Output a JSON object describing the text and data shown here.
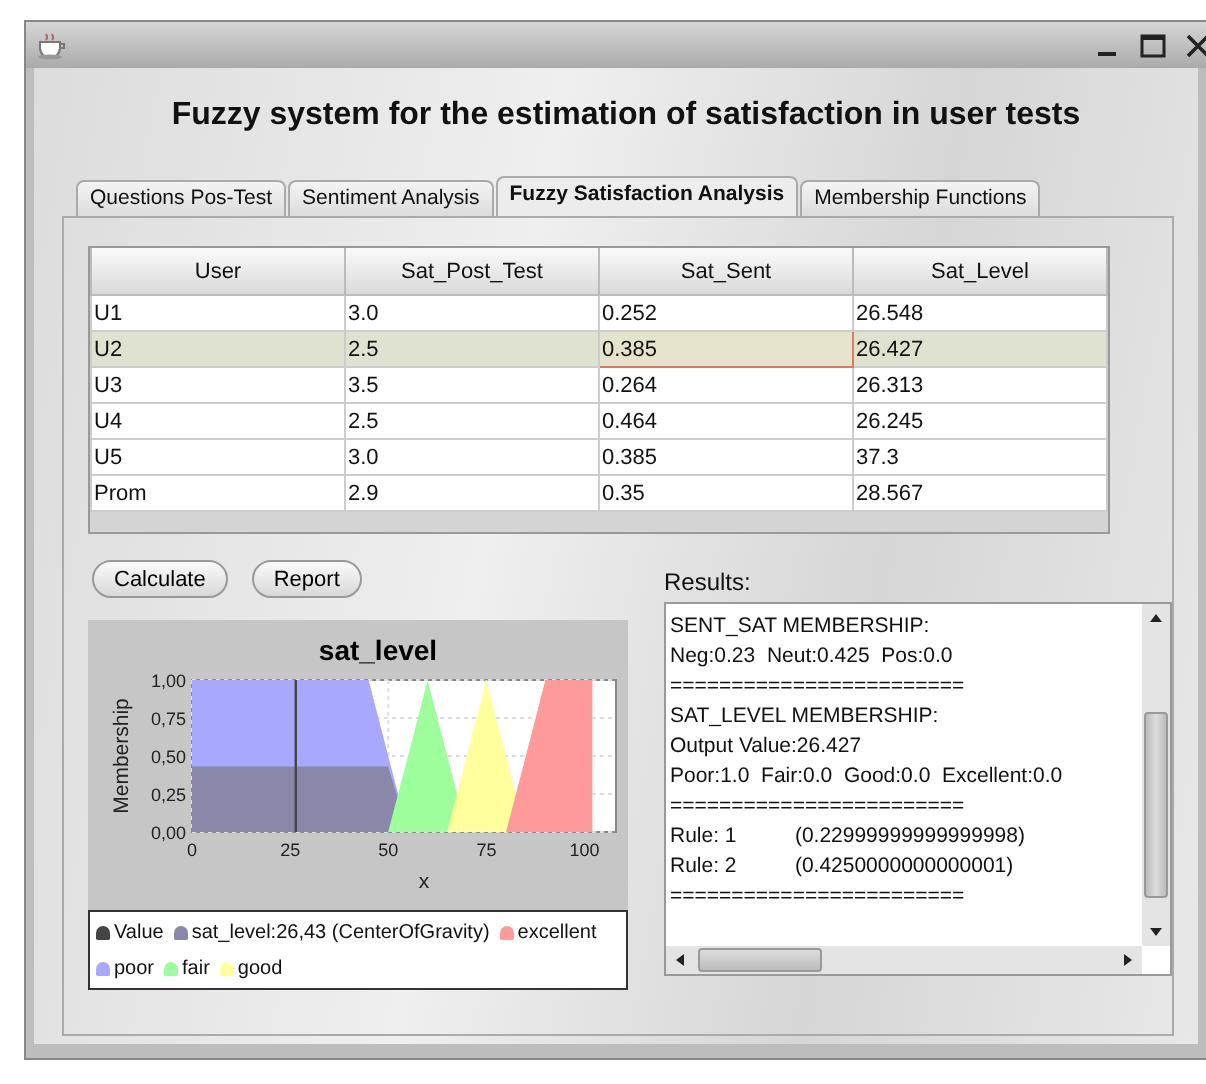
{
  "window": {
    "heading": "Fuzzy system for the estimation of satisfaction in user tests"
  },
  "tabs": [
    {
      "label": "Questions Pos-Test",
      "selected": false
    },
    {
      "label": "Sentiment Analysis",
      "selected": false
    },
    {
      "label": "Fuzzy Satisfaction Analysis",
      "selected": true
    },
    {
      "label": "Membership Functions",
      "selected": false
    }
  ],
  "table": {
    "columns": [
      "User",
      "Sat_Post_Test",
      "Sat_Sent",
      "Sat_Level"
    ],
    "rows": [
      {
        "selected": false,
        "cells": [
          {
            "text": "U1",
            "focused": false
          },
          {
            "text": "3.0",
            "focused": false
          },
          {
            "text": "0.252",
            "focused": false
          },
          {
            "text": "26.548",
            "focused": false
          }
        ]
      },
      {
        "selected": true,
        "cells": [
          {
            "text": "U2",
            "focused": false
          },
          {
            "text": "2.5",
            "focused": false
          },
          {
            "text": "0.385",
            "focused": true
          },
          {
            "text": "26.427",
            "focused": false
          }
        ]
      },
      {
        "selected": false,
        "cells": [
          {
            "text": "U3",
            "focused": false
          },
          {
            "text": "3.5",
            "focused": false
          },
          {
            "text": "0.264",
            "focused": false
          },
          {
            "text": "26.313",
            "focused": false
          }
        ]
      },
      {
        "selected": false,
        "cells": [
          {
            "text": "U4",
            "focused": false
          },
          {
            "text": "2.5",
            "focused": false
          },
          {
            "text": "0.464",
            "focused": false
          },
          {
            "text": "26.245",
            "focused": false
          }
        ]
      },
      {
        "selected": false,
        "cells": [
          {
            "text": "U5",
            "focused": false
          },
          {
            "text": "3.0",
            "focused": false
          },
          {
            "text": "0.385",
            "focused": false
          },
          {
            "text": "37.3",
            "focused": false
          }
        ]
      },
      {
        "selected": false,
        "cells": [
          {
            "text": "Prom",
            "focused": false
          },
          {
            "text": "2.9",
            "focused": false
          },
          {
            "text": "0.35",
            "focused": false
          },
          {
            "text": "28.567",
            "focused": false
          }
        ]
      }
    ]
  },
  "buttons": [
    "Calculate",
    "Report"
  ],
  "chart": {
    "chart_data": {
      "type": "area",
      "title": "sat_level",
      "xlabel": "x",
      "ylabel": "Membership",
      "x": [
        0,
        45,
        50,
        55,
        60,
        65,
        70,
        75,
        80,
        85,
        90,
        102
      ],
      "series": [
        {
          "name": "sat_level:26,43 (CenterOfGravity)",
          "color": "#8a88a8",
          "values": [
            0.43,
            0.43,
            0.43,
            0,
            null,
            null,
            null,
            null,
            null,
            null,
            null,
            null
          ]
        },
        {
          "name": "excellent",
          "color": "#ff9a9a",
          "values": [
            null,
            null,
            null,
            null,
            null,
            null,
            null,
            null,
            0,
            0.5,
            1,
            1
          ]
        },
        {
          "name": "poor",
          "color": "#a8a8ff",
          "values": [
            1,
            1,
            0.5,
            0,
            null,
            null,
            null,
            null,
            null,
            null,
            null,
            null
          ]
        },
        {
          "name": "fair",
          "color": "#9cff9c",
          "values": [
            null,
            null,
            0,
            0.5,
            1,
            0.5,
            0,
            null,
            null,
            null,
            null,
            null
          ]
        },
        {
          "name": "good",
          "color": "#ffff9c",
          "values": [
            null,
            null,
            null,
            null,
            null,
            0,
            0.5,
            1,
            0.5,
            0,
            null,
            null
          ]
        }
      ],
      "xlim": [
        0,
        108
      ],
      "ylim": [
        0,
        1
      ],
      "xticks": [
        0,
        25,
        50,
        75,
        100
      ],
      "yticks": [
        {
          "value": 0,
          "label": "0,00"
        },
        {
          "value": 0.25,
          "label": "0,25"
        },
        {
          "value": 0.5,
          "label": "0,50"
        },
        {
          "value": 0.75,
          "label": "0,75"
        },
        {
          "value": 1,
          "label": "1,00"
        }
      ],
      "grid": true,
      "ref_lines": [
        {
          "axis": "x",
          "value": 26.43,
          "label": "Value",
          "color": "#444444"
        }
      ]
    }
  },
  "results": {
    "label": "Results:",
    "lines": [
      "SENT_SAT MEMBERSHIP:",
      "Neg:0.23  Neut:0.425  Pos:0.0",
      "========================",
      "SAT_LEVEL MEMBERSHIP:",
      "Output Value:26.427",
      "Poor:1.0  Fair:0.0  Good:0.0  Excellent:0.0",
      "========================",
      "Rule: 1          (0.22999999999999998)",
      "Rule: 2          (0.4250000000000001)",
      "========================"
    ]
  }
}
